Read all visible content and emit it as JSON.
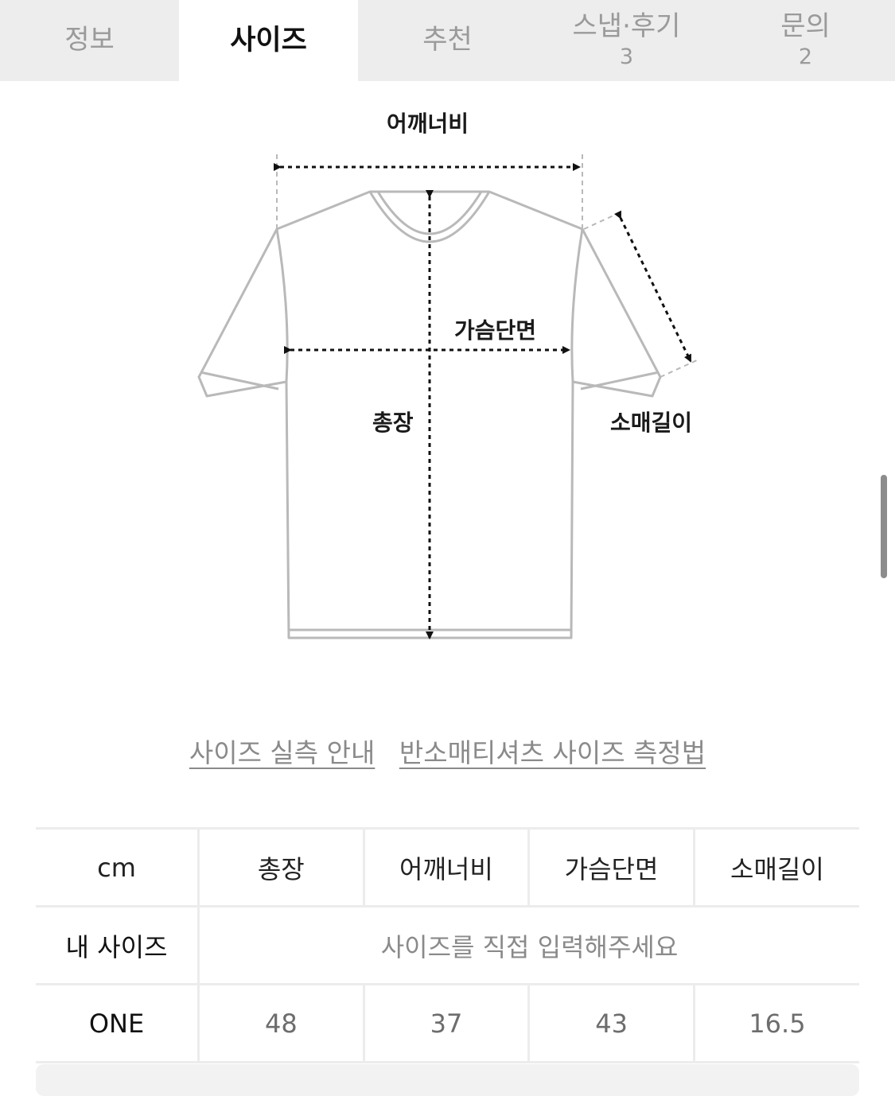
{
  "tabs": [
    {
      "label": "정보",
      "count": ""
    },
    {
      "label": "사이즈",
      "count": ""
    },
    {
      "label": "추천",
      "count": ""
    },
    {
      "label": "스냅·후기",
      "count": "3"
    },
    {
      "label": "문의",
      "count": "2"
    }
  ],
  "diagram": {
    "shoulder": "어깨너비",
    "chest": "가슴단면",
    "length": "총장",
    "sleeve": "소매길이"
  },
  "links": {
    "size_guide": "사이즈 실측 안내",
    "measure_method": "반소매티셔츠 사이즈 측정법"
  },
  "table": {
    "unit": "cm",
    "headers": [
      "총장",
      "어깨너비",
      "가슴단면",
      "소매길이"
    ],
    "my_size_label": "내 사이즈",
    "my_size_placeholder": "사이즈를 직접 입력해주세요",
    "rows": [
      {
        "name": "ONE",
        "values": [
          "48",
          "37",
          "43",
          "16.5"
        ]
      }
    ]
  }
}
